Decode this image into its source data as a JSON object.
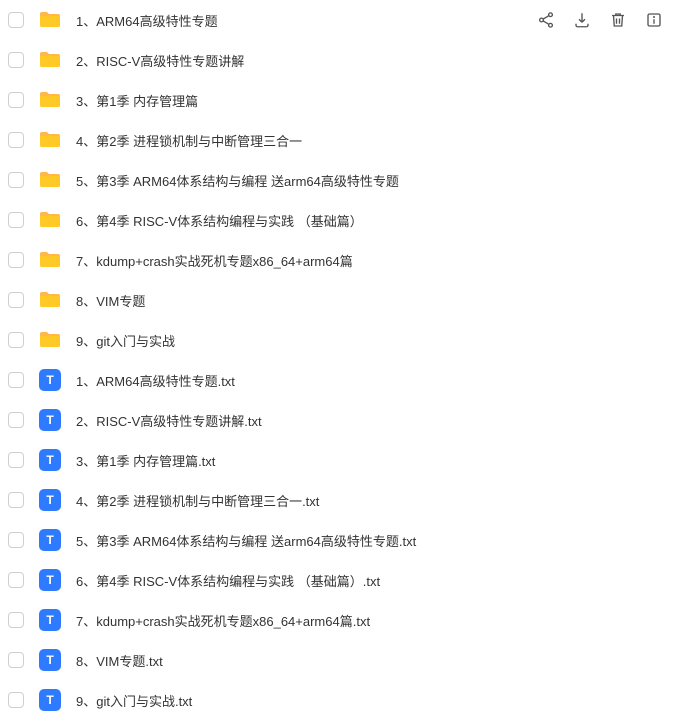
{
  "items": [
    {
      "type": "folder",
      "name": "1、ARM64高级特性专题",
      "showActions": true
    },
    {
      "type": "folder",
      "name": "2、RISC-V高级特性专题讲解",
      "showActions": false
    },
    {
      "type": "folder",
      "name": "3、第1季 内存管理篇",
      "showActions": false
    },
    {
      "type": "folder",
      "name": "4、第2季 进程锁机制与中断管理三合一",
      "showActions": false
    },
    {
      "type": "folder",
      "name": "5、第3季 ARM64体系结构与编程 送arm64高级特性专题",
      "showActions": false
    },
    {
      "type": "folder",
      "name": "6、第4季 RISC-V体系结构编程与实践 （基础篇）",
      "showActions": false
    },
    {
      "type": "folder",
      "name": "7、kdump+crash实战死机专题x86_64+arm64篇",
      "showActions": false
    },
    {
      "type": "folder",
      "name": "8、VIM专题",
      "showActions": false
    },
    {
      "type": "folder",
      "name": "9、git入门与实战",
      "showActions": false
    },
    {
      "type": "txt",
      "name": "1、ARM64高级特性专题.txt",
      "showActions": false
    },
    {
      "type": "txt",
      "name": "2、RISC-V高级特性专题讲解.txt",
      "showActions": false
    },
    {
      "type": "txt",
      "name": "3、第1季 内存管理篇.txt",
      "showActions": false
    },
    {
      "type": "txt",
      "name": "4、第2季 进程锁机制与中断管理三合一.txt",
      "showActions": false
    },
    {
      "type": "txt",
      "name": "5、第3季 ARM64体系结构与编程 送arm64高级特性专题.txt",
      "showActions": false
    },
    {
      "type": "txt",
      "name": "6、第4季 RISC-V体系结构编程与实践 （基础篇）.txt",
      "showActions": false
    },
    {
      "type": "txt",
      "name": "7、kdump+crash实战死机专题x86_64+arm64篇.txt",
      "showActions": false
    },
    {
      "type": "txt",
      "name": "8、VIM专题.txt",
      "showActions": false
    },
    {
      "type": "txt",
      "name": "9、git入门与实战.txt",
      "showActions": false
    }
  ],
  "txtBadge": "T"
}
